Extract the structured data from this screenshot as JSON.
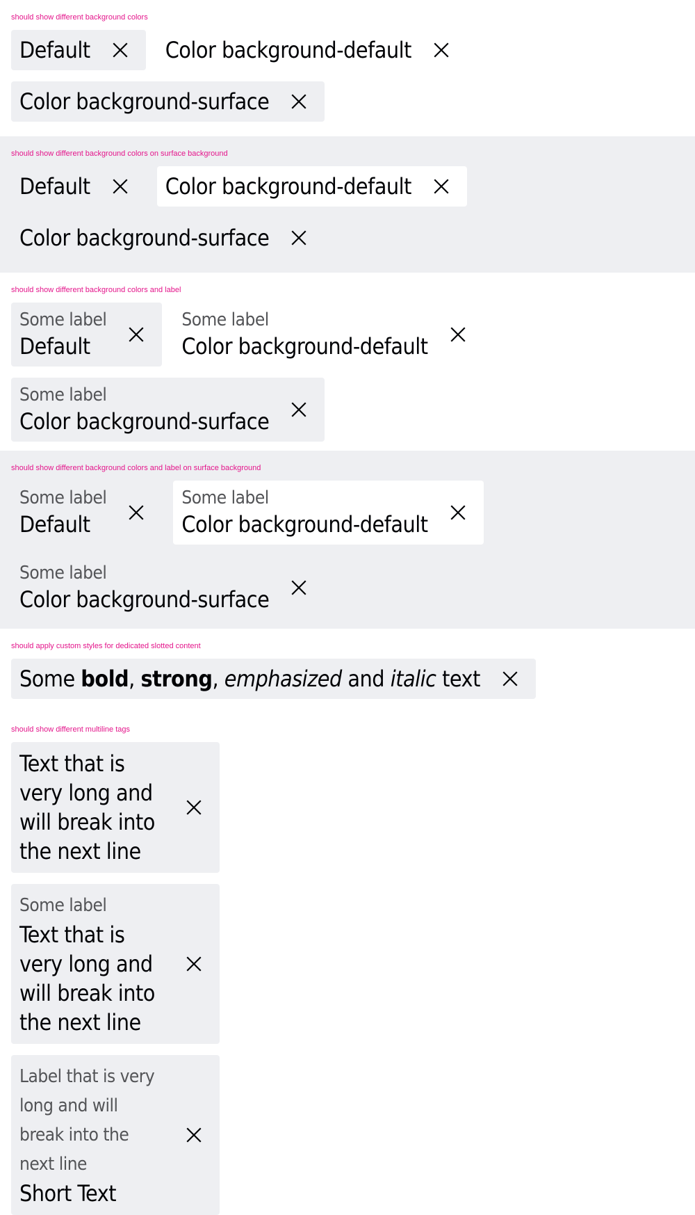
{
  "sections": {
    "bg": {
      "title": "should show different background colors",
      "tags": [
        "Default",
        "Color background-default",
        "Color background-surface"
      ]
    },
    "bg_surface": {
      "title": "should show different background colors on surface background",
      "tags": [
        "Default",
        "Color background-default",
        "Color background-surface"
      ]
    },
    "label": {
      "title": "should show different background colors and label",
      "label": "Some label",
      "tags": [
        "Default",
        "Color background-default",
        "Color background-surface"
      ]
    },
    "label_surface": {
      "title": "should show different background colors and label on surface background",
      "label": "Some label",
      "tags": [
        "Default",
        "Color background-default",
        "Color background-surface"
      ]
    },
    "custom": {
      "title": "should apply custom styles for dedicated slotted content",
      "parts": [
        "Some",
        "bold",
        ",",
        "strong",
        ",",
        "emphasized",
        "and",
        "italic",
        "text"
      ]
    },
    "multiline": {
      "title": "should show different multiline tags",
      "text": "Text that is very long and will break into the next line",
      "label": "Some label",
      "long_label": "Label that is very long and will break into the next line",
      "short_text": "Short Text"
    }
  },
  "colors": {
    "surface": "#eeeff2",
    "background_default": "#ffffff",
    "title_pink": "#e4158b",
    "text": "#010205",
    "label": "#535457"
  },
  "icons": {
    "dismiss": "close-icon"
  }
}
